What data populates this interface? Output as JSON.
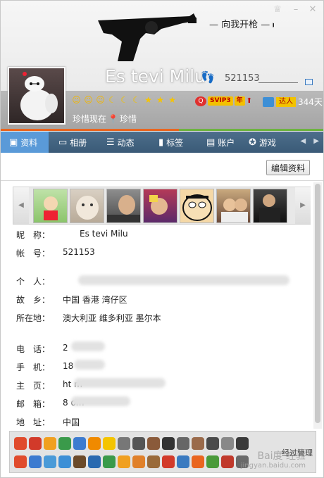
{
  "header": {
    "banner_text": "一向我开枪 一",
    "nickname": "Es tevi Milu",
    "uin": "521153",
    "status_text": "珍惜现在",
    "location_text": "珍惜",
    "vip_label": "SVIP3",
    "vip_year": "年",
    "daren_label": "达人",
    "days": "344天"
  },
  "tabs": [
    {
      "label": "资料",
      "icon": "profile-icon"
    },
    {
      "label": "相册",
      "icon": "album-icon"
    },
    {
      "label": "动态",
      "icon": "feed-icon"
    },
    {
      "label": "标签",
      "icon": "tag-icon"
    },
    {
      "label": "账户",
      "icon": "wallet-icon"
    },
    {
      "label": "游戏",
      "icon": "game-icon"
    }
  ],
  "toolbar": {
    "edit_label": "编辑资料"
  },
  "details": [
    {
      "key": "昵　称：",
      "value": "Es tevi Milu"
    },
    {
      "key": "帐　号：",
      "value": "521153"
    },
    {
      "key": "个　人：",
      "value": ""
    },
    {
      "key": "故　乡：",
      "value": "中国 香港 湾仔区"
    },
    {
      "key": "所在地：",
      "value": "澳大利亚 维多利亚 墨尔本"
    },
    {
      "key": "电　话：",
      "value": "2"
    },
    {
      "key": "手　机：",
      "value": "18"
    },
    {
      "key": "主　页：",
      "value": "ht                                  m"
    },
    {
      "key": "邮　箱：",
      "value": "8                  om"
    },
    {
      "key": "地　址：",
      "value": "中国"
    }
  ],
  "watermark": {
    "main": "Bai度 经验",
    "sub": "jingyan.baidu.com",
    "overlay": "经过管理"
  },
  "colors": {
    "tab_bar": "#3f607d",
    "tab_active": "#5a9ad8",
    "accent_orange": "#e9651f",
    "accent_green": "#6db33f"
  }
}
